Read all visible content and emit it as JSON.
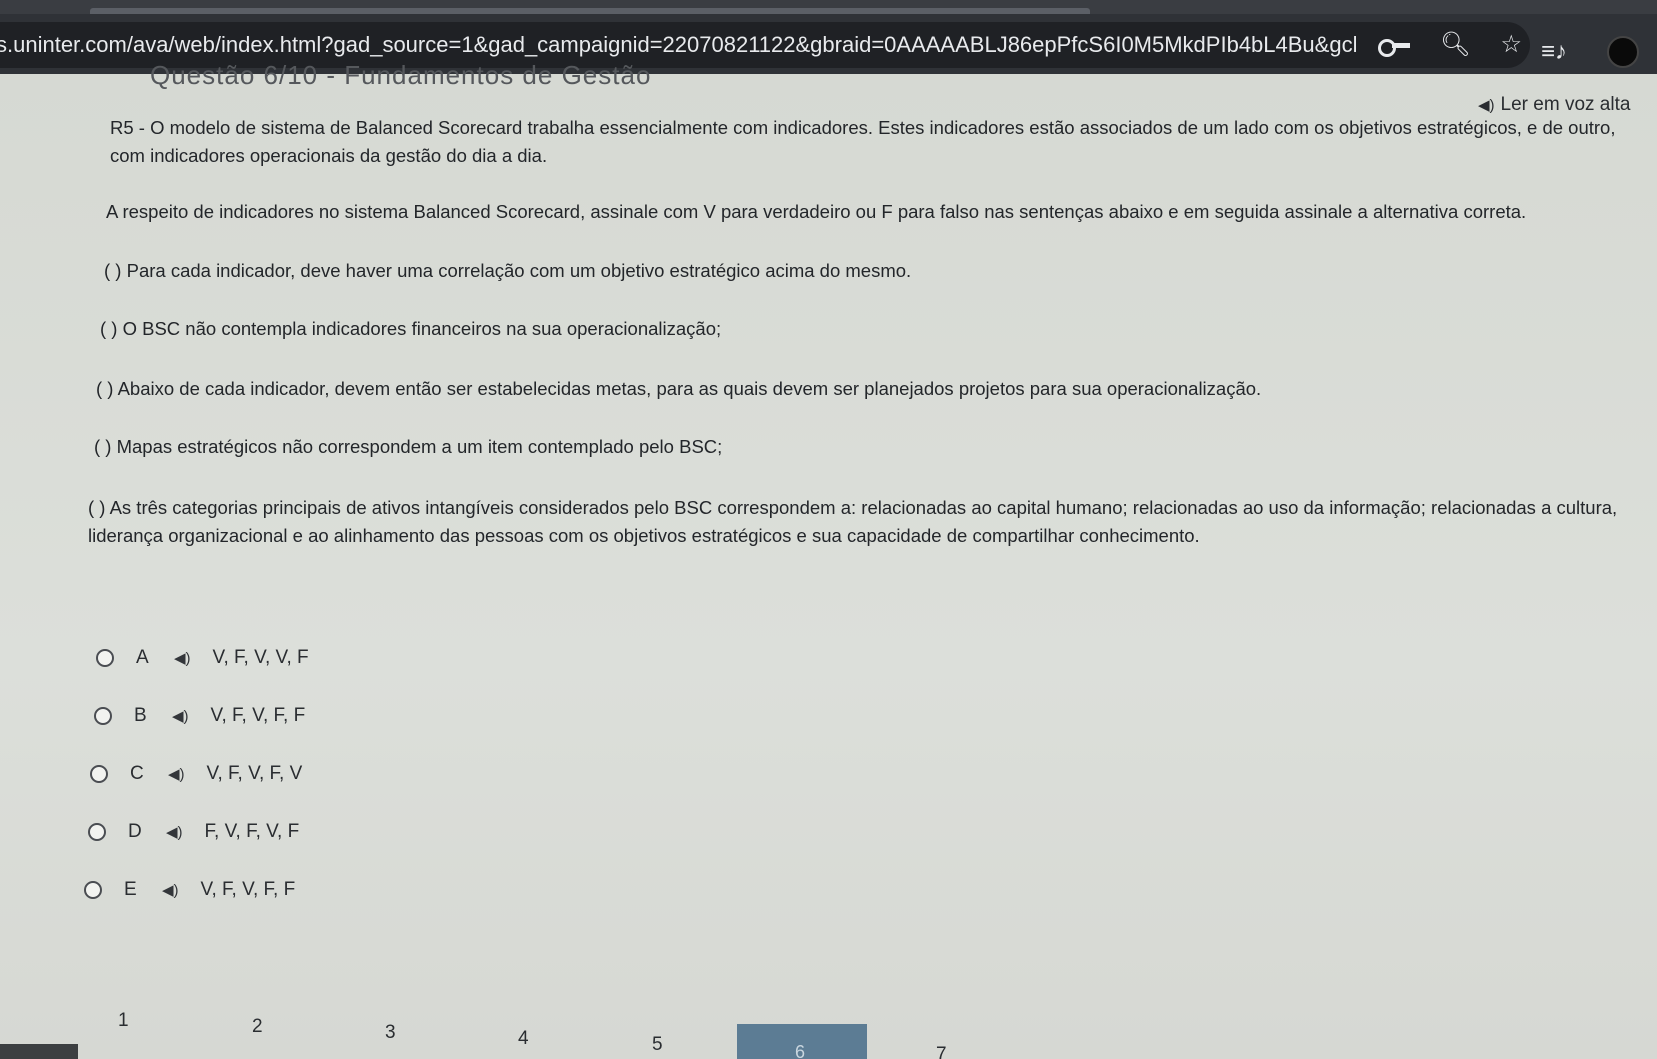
{
  "browser": {
    "url": "s.uninter.com/ava/web/index.html?gad_source=1&gad_campaignid=22070821122&gbraid=0AAAAABLJ86epPfcS6I0M5MkdPIb4bL4Bu&gclid=CjwKC..."
  },
  "page": {
    "header_cut": "Questão 6/10 - Fundamentos de Gestão",
    "read_aloud": "Ler em voz alta",
    "question_p1": "R5 - O modelo de sistema de Balanced Scorecard trabalha essencialmente com indicadores.  Estes indicadores estão associados de um lado com os objetivos estratégicos, e de outro, com indicadores operacionais da gestão do dia a dia.",
    "question_p2": "A respeito de indicadores no sistema Balanced Scorecard, assinale com V para verdadeiro ou F para falso nas sentenças abaixo e em seguida assinale a alternativa correta.",
    "statements": [
      "(   ) Para cada indicador, deve haver uma correlação com um objetivo estratégico acima do mesmo.",
      "(   ) O BSC não contempla indicadores financeiros na sua operacionalização;",
      "(   ) Abaixo de cada indicador, devem então ser estabelecidas metas, para as quais devem ser planejados projetos para sua operacionalização.",
      "(   ) Mapas estratégicos não correspondem a um item contemplado pelo BSC;",
      "(   ) As três categorias principais de ativos intangíveis considerados pelo BSC correspondem a: relacionadas ao capital humano; relacionadas ao uso da informação; relacionadas a cultura, liderança organizacional e ao alinhamento das pessoas com os objetivos estratégicos e sua capacidade de compartilhar conhecimento."
    ],
    "options": [
      {
        "letter": "A",
        "text": "V, F, V, V, F"
      },
      {
        "letter": "B",
        "text": "V, F, V, F, F"
      },
      {
        "letter": "C",
        "text": "V, F, V, F, V"
      },
      {
        "letter": "D",
        "text": "F, V, F, V, F"
      },
      {
        "letter": "E",
        "text": "V, F, V, F, F"
      }
    ],
    "pagination": [
      "1",
      "2",
      "3",
      "4",
      "5",
      "6",
      "7"
    ],
    "current_page": "6"
  },
  "colors": {
    "page_bg": "#d8dbd6",
    "browser_bg": "#2f3237",
    "active_page": "#5c7c94"
  }
}
